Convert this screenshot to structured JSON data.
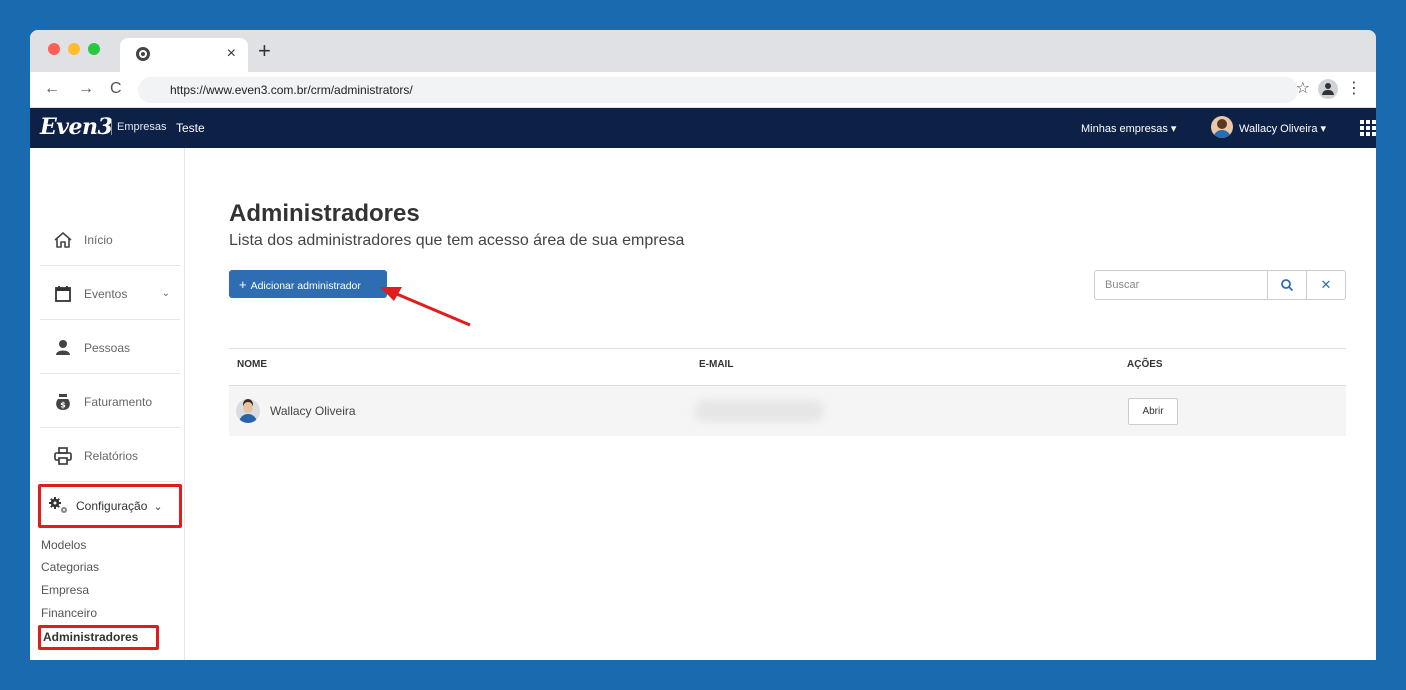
{
  "browser": {
    "tab_close": "×",
    "new_tab": "+",
    "back": "←",
    "forward": "→",
    "reload": "C",
    "url": "https://www.even3.com.br/crm/administrators/",
    "star": "☆",
    "menu": "⋮"
  },
  "header": {
    "logo": "Even3",
    "section": "Empresas",
    "company": "Teste",
    "companies_menu": "Minhas empresas ▾",
    "user_menu": "Wallacy Oliveira ▾"
  },
  "sidebar": {
    "items": [
      {
        "label": "Início",
        "icon": "home-icon"
      },
      {
        "label": "Eventos",
        "icon": "calendar-icon",
        "chevron": "⌄"
      },
      {
        "label": "Pessoas",
        "icon": "person-icon"
      },
      {
        "label": "Faturamento",
        "icon": "money-bag-icon"
      },
      {
        "label": "Relatórios",
        "icon": "printer-icon"
      }
    ],
    "config": {
      "label": "Configuração",
      "chevron": "⌄",
      "icon": "gears-icon"
    },
    "sub_items": [
      "Modelos",
      "Categorias",
      "Empresa",
      "Financeiro"
    ],
    "active_sub": "Administradores"
  },
  "main": {
    "title": "Administradores",
    "subtitle": "Lista dos administradores que tem acesso área de sua empresa",
    "add_button": {
      "plus": "+",
      "label": "Adicionar administrador"
    },
    "search_placeholder": "Buscar",
    "clear": "✕",
    "table": {
      "headers": [
        "NOME",
        "E-MAIL",
        "AÇÕES"
      ],
      "rows": [
        {
          "name": "Wallacy Oliveira",
          "action": "Abrir"
        }
      ]
    }
  },
  "colors": {
    "background": "#1a6ab0",
    "appbar": "#0d2146",
    "primary_button": "#2f6db3",
    "annotation": "#e01c1c"
  }
}
